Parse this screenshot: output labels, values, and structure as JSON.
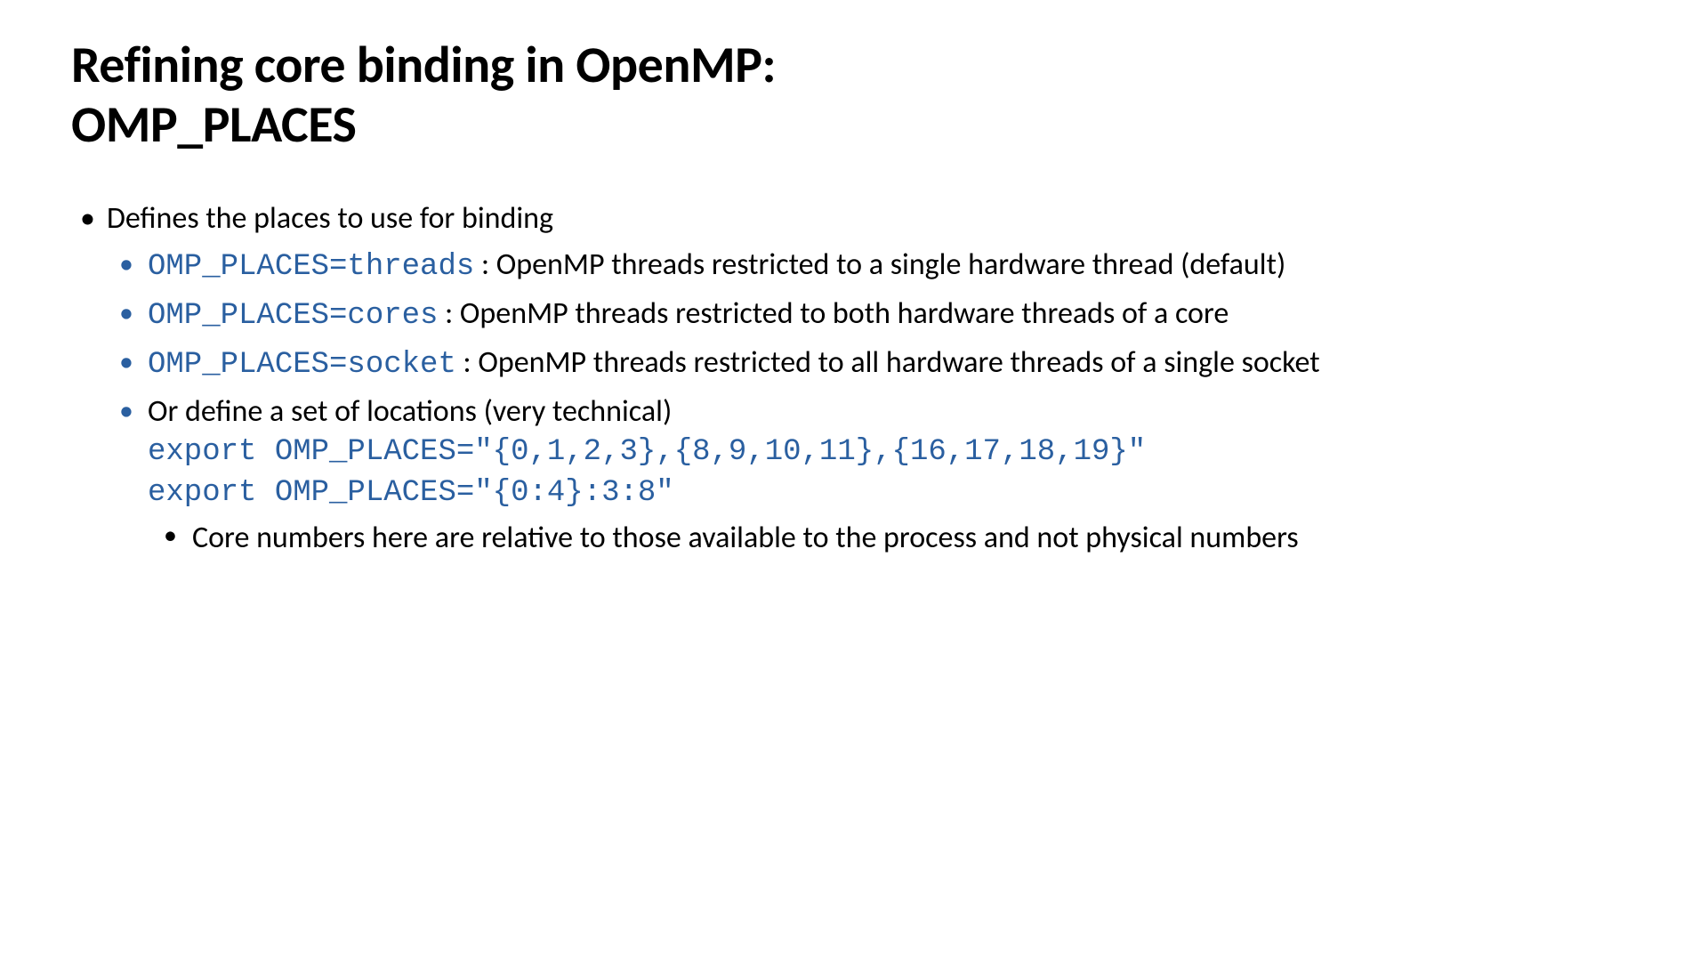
{
  "title_line1": "Refining core binding in OpenMP:",
  "title_line2": "OMP_PLACES",
  "bullet_main": "Defines the places to use for binding",
  "sub1_code": "OMP_PLACES=threads",
  "sub1_text": " : OpenMP threads restricted to a single hardware thread (default)",
  "sub2_code": "OMP_PLACES=cores",
  "sub2_text": " : OpenMP threads restricted to both hardware threads of a core",
  "sub3_code": "OMP_PLACES=socket",
  "sub3_text": " : OpenMP threads restricted to all hardware threads of a single socket",
  "sub4_text": "Or define a set of locations (very technical)",
  "sub4_code1": "export OMP_PLACES=\"{0,1,2,3},{8,9,10,11},{16,17,18,19}\"",
  "sub4_code2": "export OMP_PLACES=\"{0:4}:3:8\"",
  "sub4_sub1": "Core numbers here are relative to those available to the process and not physical numbers"
}
